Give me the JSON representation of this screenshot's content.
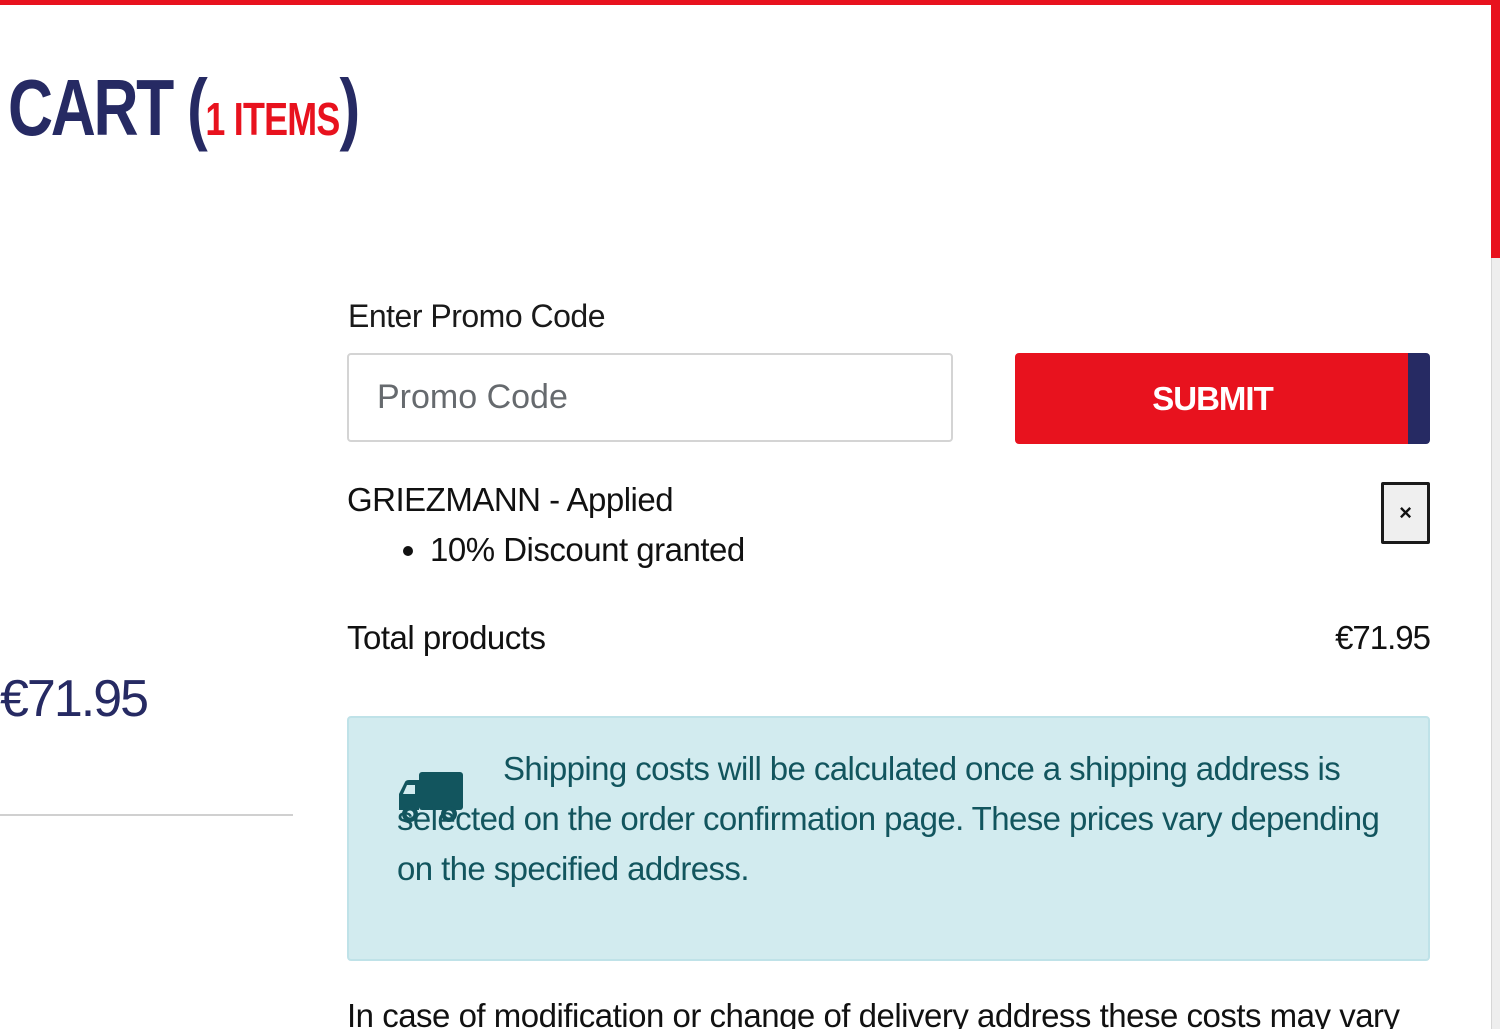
{
  "header": {
    "title": "CART",
    "paren_open": "(",
    "item_count": "1 ITEMS",
    "paren_close": ")"
  },
  "summary": {
    "left_price": "€71.95"
  },
  "promo": {
    "label": "Enter Promo Code",
    "input_placeholder": "Promo Code",
    "input_value": "",
    "submit_label": "SUBMIT",
    "applied_text": "GRIEZMANN - Applied",
    "discounts": [
      "10% Discount granted"
    ],
    "remove_label": "×"
  },
  "totals": {
    "label": "Total products",
    "value": "€71.95"
  },
  "shipping": {
    "icon": "truck-icon",
    "message": "Shipping costs will be calculated once a shipping address is selected on the order confirmation page. These prices vary depending on the specified address."
  },
  "footer_note": "In case of modification or change of delivery address these costs may vary",
  "colors": {
    "brand_red": "#e8121e",
    "brand_navy": "#262a63",
    "info_bg": "#d2ebef",
    "info_text": "#12555e"
  }
}
